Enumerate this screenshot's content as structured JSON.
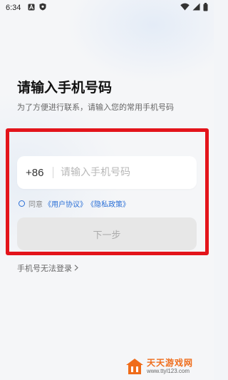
{
  "status_bar": {
    "time": "6:34",
    "icons_left": [
      "a-icon",
      "shield-icon"
    ],
    "icons_right": [
      "wifi-icon",
      "signal-icon",
      "battery-icon"
    ]
  },
  "login": {
    "title": "请输入手机号码",
    "subtitle": "为了方便进行联系，请输入您的常用手机号码",
    "country_code": "+86",
    "phone_placeholder": "请输入手机号码",
    "phone_value": "",
    "agree_prefix": "同意",
    "user_agreement": "《用户协议》",
    "privacy_policy": "《隐私政策》",
    "next_button": "下一步",
    "cannot_login": "手机号无法登录"
  },
  "watermark": {
    "brand": "天天游戏网",
    "url": "www.ttyl123.com"
  },
  "colors": {
    "highlight_border": "#e3141b",
    "link": "#2a6fd6",
    "watermark_orange": "#ef6c1a"
  }
}
